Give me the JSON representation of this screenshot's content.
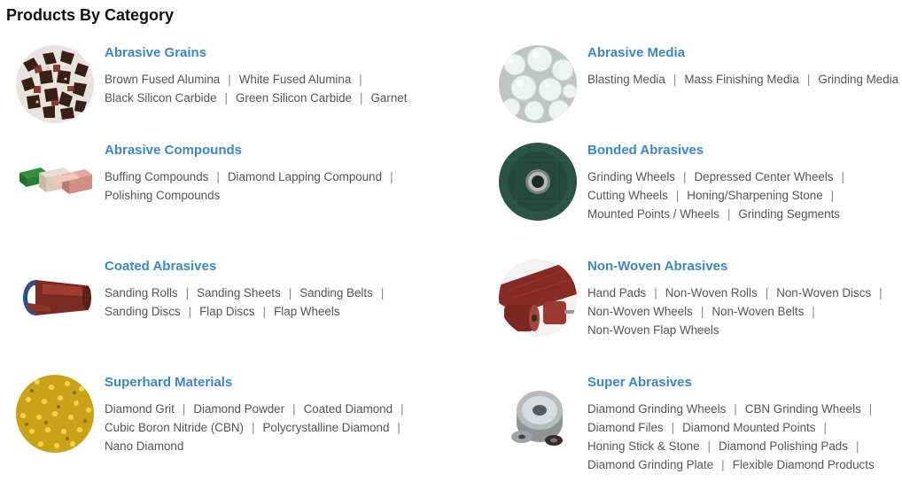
{
  "page": {
    "title": "Products By Category"
  },
  "categories": [
    {
      "id": "abrasive-grains",
      "title": "Abrasive Grains",
      "image": "abrasive-grains-thumbnail",
      "lines": [
        [
          {
            "text": "Brown Fused Alumina"
          },
          {
            "text": "White Fused Alumina"
          }
        ],
        [
          {
            "text": "Black Silicon Carbide"
          },
          {
            "text": "Green Silicon Carbide"
          },
          {
            "text": "Garnet"
          }
        ]
      ],
      "trailing_sep": [
        true,
        false
      ]
    },
    {
      "id": "abrasive-media",
      "title": "Abrasive Media",
      "image": "abrasive-media-thumbnail",
      "lines": [
        [
          {
            "text": "Blasting Media"
          },
          {
            "text": "Mass Finishing Media"
          },
          {
            "text": "Grinding Media"
          }
        ]
      ],
      "trailing_sep": [
        false
      ]
    },
    {
      "id": "abrasive-compounds",
      "title": "Abrasive Compounds",
      "image": "abrasive-compounds-thumbnail",
      "lines": [
        [
          {
            "text": "Buffing Compounds"
          },
          {
            "text": "Diamond Lapping Compound"
          }
        ],
        [
          {
            "text": "Polishing Compounds"
          }
        ]
      ],
      "trailing_sep": [
        true,
        false
      ]
    },
    {
      "id": "bonded-abrasives",
      "title": "Bonded Abrasives",
      "image": "bonded-abrasives-thumbnail",
      "lines": [
        [
          {
            "text": "Grinding Wheels"
          },
          {
            "text": "Depressed Center Wheels"
          }
        ],
        [
          {
            "text": "Cutting Wheels"
          },
          {
            "text": "Honing/Sharpening Stone"
          }
        ],
        [
          {
            "text": "Mounted Points / Wheels"
          },
          {
            "text": "Grinding Segments"
          }
        ]
      ],
      "trailing_sep": [
        true,
        true,
        false
      ]
    },
    {
      "id": "coated-abrasives",
      "title": "Coated Abrasives",
      "image": "coated-abrasives-thumbnail",
      "lines": [
        [
          {
            "text": "Sanding Rolls"
          },
          {
            "text": "Sanding Sheets"
          },
          {
            "text": "Sanding Belts"
          }
        ],
        [
          {
            "text": "Sanding Discs"
          },
          {
            "text": "Flap Discs"
          },
          {
            "text": "Flap Wheels"
          }
        ]
      ],
      "trailing_sep": [
        true,
        false
      ]
    },
    {
      "id": "non-woven-abrasives",
      "title": "Non-Woven Abrasives",
      "image": "non-woven-abrasives-thumbnail",
      "lines": [
        [
          {
            "text": "Hand Pads"
          },
          {
            "text": "Non-Woven Rolls"
          },
          {
            "text": "Non-Woven Discs"
          }
        ],
        [
          {
            "text": "Non-Woven Wheels"
          },
          {
            "text": "Non-Woven Belts"
          }
        ],
        [
          {
            "text": "Non-Woven Flap Wheels"
          }
        ]
      ],
      "trailing_sep": [
        true,
        true,
        false
      ]
    },
    {
      "id": "superhard-materials",
      "title": "Superhard Materials",
      "image": "superhard-materials-thumbnail",
      "lines": [
        [
          {
            "text": "Diamond Grit"
          },
          {
            "text": "Diamond Powder"
          },
          {
            "text": "Coated Diamond"
          }
        ],
        [
          {
            "text": "Cubic Boron Nitride (CBN)"
          },
          {
            "text": "Polycrystalline Diamond"
          }
        ],
        [
          {
            "text": "Nano Diamond"
          }
        ]
      ],
      "trailing_sep": [
        true,
        true,
        false
      ]
    },
    {
      "id": "super-abrasives",
      "title": "Super Abrasives",
      "image": "super-abrasives-thumbnail",
      "lines": [
        [
          {
            "text": "Diamond Grinding Wheels"
          },
          {
            "text": "CBN Grinding Wheels"
          }
        ],
        [
          {
            "text": "Diamond Files"
          },
          {
            "text": "Diamond Mounted Points"
          }
        ],
        [
          {
            "text": "Honing Stick & Stone"
          },
          {
            "text": "Diamond Polishing Pads"
          }
        ],
        [
          {
            "text": "Diamond Grinding Plate"
          },
          {
            "text": "Flexible Diamond Products"
          }
        ]
      ],
      "trailing_sep": [
        true,
        true,
        true,
        false
      ]
    }
  ],
  "separator": "|"
}
